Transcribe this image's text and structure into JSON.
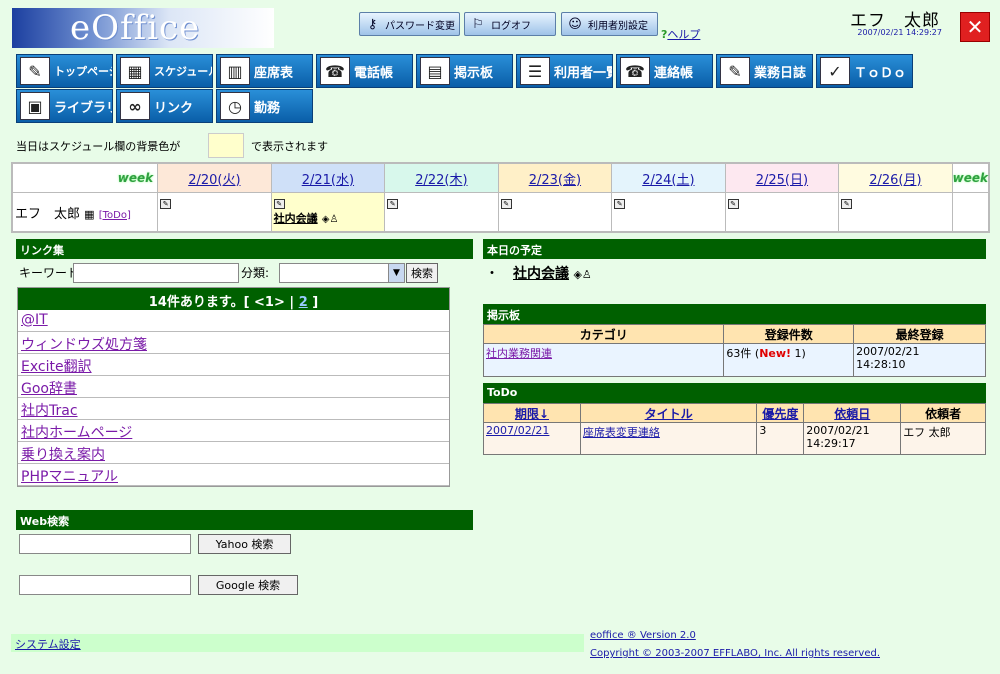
{
  "header": {
    "logo_text": "eOffice",
    "toolbar": [
      {
        "label": "パスワード変更",
        "icon": "key-icon"
      },
      {
        "label": "ログオフ",
        "icon": "logoff-icon"
      },
      {
        "label": "利用者別設定",
        "icon": "user-settings-icon"
      }
    ],
    "help_label": "ヘルプ",
    "user_name": "エフ　太郎",
    "datetime": "2007/02/21 14:29:27",
    "close_label": "✕"
  },
  "nav": [
    {
      "label": "トップページ",
      "icon": "✎",
      "name": "nav-top"
    },
    {
      "label": "スケジュール",
      "icon": "▦",
      "name": "nav-schedule"
    },
    {
      "label": "座席表",
      "icon": "▥",
      "name": "nav-seats"
    },
    {
      "label": "電話帳",
      "icon": "☎",
      "name": "nav-phonebook"
    },
    {
      "label": "掲示板",
      "icon": "▤",
      "name": "nav-bbs"
    },
    {
      "label": "利用者一覧",
      "icon": "☰",
      "name": "nav-users"
    },
    {
      "label": "連絡帳",
      "icon": "☎",
      "name": "nav-contacts"
    },
    {
      "label": "業務日誌",
      "icon": "✎",
      "name": "nav-diary"
    },
    {
      "label": "ＴｏＤｏ",
      "icon": "✓",
      "name": "nav-todo"
    },
    {
      "label": "ライブラリ",
      "icon": "▣",
      "name": "nav-library"
    },
    {
      "label": "リンク",
      "icon": "∞",
      "name": "nav-link"
    },
    {
      "label": "勤務",
      "icon": "◷",
      "name": "nav-work"
    }
  ],
  "notice": {
    "before": "当日はスケジュール欄の背景色が",
    "after": "で表示されます",
    "highlight_color": "#ffffcc"
  },
  "schedule": {
    "week_label": "week",
    "days": [
      {
        "label": "2/20(火)",
        "color": "#fde8d8"
      },
      {
        "label": "2/21(水)",
        "color": "#cfe0f8"
      },
      {
        "label": "2/22(木)",
        "color": "#d8f8ec"
      },
      {
        "label": "2/23(金)",
        "color": "#fff0c8"
      },
      {
        "label": "2/24(土)",
        "color": "#e4f4fc"
      },
      {
        "label": "2/25(日)",
        "color": "#fde8f0"
      },
      {
        "label": "2/26(月)",
        "color": "#fffbe0"
      }
    ],
    "user": "エフ　太郎",
    "todo_link": "[ToDo]",
    "event": "社内会議"
  },
  "links": {
    "title": "リンク集",
    "keyword_label": "キーワード:",
    "category_label": "分類:",
    "search_button": "検索",
    "count_text": "14件あります。[ <1> |",
    "page2": "2",
    "count_end": "]",
    "items": [
      "@IT",
      "ウィンドウズ処方箋",
      "Excite翻訳",
      "Goo辞書",
      "社内Trac",
      "社内ホームページ",
      "乗り換え案内",
      "PHPマニュアル"
    ]
  },
  "today": {
    "title": "本日の予定",
    "event": "社内会議"
  },
  "bbs": {
    "title": "掲示板",
    "headers": [
      "カテゴリ",
      "登録件数",
      "最終登録"
    ],
    "category": "社内業務関連",
    "count": "63件 (",
    "new_label": "New!",
    "new_count": " 1)",
    "last_date": "2007/02/21",
    "last_time": "14:28:10"
  },
  "todo": {
    "title": "ToDo",
    "headers": [
      "期限↓",
      "タイトル",
      "優先度",
      "依頼日",
      "依頼者"
    ],
    "due": "2007/02/21",
    "item_title": "座席表変更連絡",
    "priority": "3",
    "req_date": "2007/02/21",
    "req_time": "14:29:17",
    "requester": "エフ 太郎"
  },
  "websearch": {
    "title": "Web検索",
    "yahoo_button": "Yahoo 検索",
    "google_button": "Google 検索"
  },
  "footer": {
    "settings": "システム設定",
    "version": "eoffice ® Version 2.0",
    "copyright": "Copyright © 2003-2007 EFFLABO, Inc. All rights reserved."
  }
}
